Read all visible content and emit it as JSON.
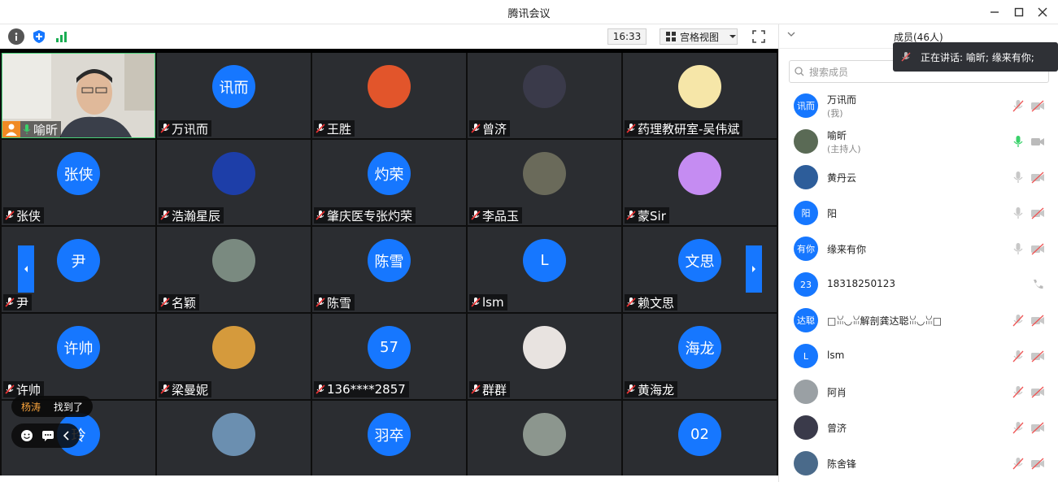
{
  "window": {
    "title": "腾讯会议"
  },
  "toolbar": {
    "time": "16:33",
    "view_label": "宫格视图"
  },
  "grid": {
    "tiles": [
      {
        "name": "喻昕",
        "avatar_text": "",
        "kind": "video"
      },
      {
        "name": "万讯而",
        "avatar_text": "讯而",
        "kind": "text"
      },
      {
        "name": "王胜",
        "avatar_text": "",
        "kind": "photo",
        "color": "#e2552b"
      },
      {
        "name": "曾济",
        "avatar_text": "",
        "kind": "photo",
        "color": "#3a3a4a"
      },
      {
        "name": "药理教研室-吴伟斌",
        "avatar_text": "",
        "kind": "photo",
        "color": "#f6e6a8"
      },
      {
        "name": "张侠",
        "avatar_text": "张侠",
        "kind": "text"
      },
      {
        "name": "浩瀚星辰",
        "avatar_text": "",
        "kind": "photo",
        "color": "#1d3ea8"
      },
      {
        "name": "肇庆医专张灼荣",
        "avatar_text": "灼荣",
        "kind": "text"
      },
      {
        "name": "李品玉",
        "avatar_text": "",
        "kind": "photo",
        "color": "#6a6a5a"
      },
      {
        "name": "蒙Sir",
        "avatar_text": "",
        "kind": "photo",
        "color": "#c58cf2"
      },
      {
        "name": "尹",
        "avatar_text": "尹",
        "kind": "text"
      },
      {
        "name": "名颖",
        "avatar_text": "",
        "kind": "photo",
        "color": "#7a8a80"
      },
      {
        "name": "陈雪",
        "avatar_text": "陈雪",
        "kind": "text"
      },
      {
        "name": "lsm",
        "avatar_text": "L",
        "kind": "text"
      },
      {
        "name": "赖文思",
        "avatar_text": "文思",
        "kind": "text"
      },
      {
        "name": "许帅",
        "avatar_text": "许帅",
        "kind": "text"
      },
      {
        "name": "梁曼妮",
        "avatar_text": "",
        "kind": "photo",
        "color": "#d59a3c"
      },
      {
        "name": "136****2857",
        "avatar_text": "57",
        "kind": "text"
      },
      {
        "name": "群群",
        "avatar_text": "",
        "kind": "photo",
        "color": "#e8e3e0"
      },
      {
        "name": "黄海龙",
        "avatar_text": "海龙",
        "kind": "text"
      },
      {
        "name": "",
        "avatar_text": "玲",
        "kind": "text"
      },
      {
        "name": "",
        "avatar_text": "",
        "kind": "photo",
        "color": "#6b8fb0"
      },
      {
        "name": "",
        "avatar_text": "羽卒",
        "kind": "text"
      },
      {
        "name": "",
        "avatar_text": "",
        "kind": "photo",
        "color": "#8c968e"
      },
      {
        "name": "",
        "avatar_text": "02",
        "kind": "text"
      }
    ]
  },
  "chat": {
    "sender": "杨涛",
    "message": "找到了"
  },
  "members": {
    "title": "成员(46人)",
    "search_placeholder": "搜索成员",
    "speaking_label": "正在讲话: 喻昕; 缘来有你;",
    "items": [
      {
        "name": "万讯而",
        "role": "(我)",
        "avatar_text": "讯而",
        "photo": "",
        "icons": "muted"
      },
      {
        "name": "喻昕",
        "role": "(主持人)",
        "avatar_text": "",
        "photo": "#5a6a55",
        "icons": "host"
      },
      {
        "name": "黄丹云",
        "role": "",
        "avatar_text": "",
        "photo": "#2d5d9a",
        "icons": "mic"
      },
      {
        "name": "阳",
        "role": "",
        "avatar_text": "阳",
        "photo": "",
        "icons": "mic"
      },
      {
        "name": "缘来有你",
        "role": "",
        "avatar_text": "有你",
        "photo": "",
        "icons": "mic"
      },
      {
        "name": "18318250123",
        "role": "",
        "avatar_text": "23",
        "photo": "",
        "icons": "phone"
      },
      {
        "name": "□ꈍ◡ꈍ解剖龚达聪ꈍ◡ꈍ□",
        "role": "",
        "avatar_text": "达聪",
        "photo": "",
        "icons": "muted"
      },
      {
        "name": "lsm",
        "role": "",
        "avatar_text": "L",
        "photo": "",
        "icons": "muted"
      },
      {
        "name": "阿肖",
        "role": "",
        "avatar_text": "",
        "photo": "#9aa0a4",
        "icons": "muted"
      },
      {
        "name": "曾济",
        "role": "",
        "avatar_text": "",
        "photo": "#3a3a4a",
        "icons": "muted"
      },
      {
        "name": "陈舍锋",
        "role": "",
        "avatar_text": "",
        "photo": "#4a6a8a",
        "icons": "muted"
      }
    ]
  }
}
